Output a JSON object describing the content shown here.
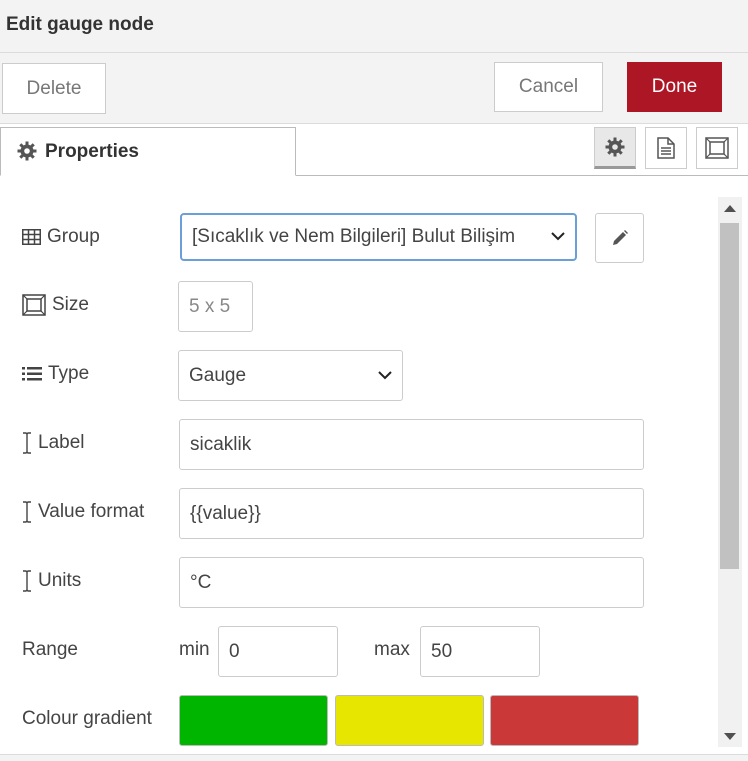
{
  "dialog": {
    "title": "Edit gauge node"
  },
  "toolbar": {
    "delete_label": "Delete",
    "cancel_label": "Cancel",
    "done_label": "Done"
  },
  "tabs": {
    "properties_label": "Properties",
    "active": "settings"
  },
  "form": {
    "group": {
      "label": "Group",
      "value": "[Sıcaklık ve Nem Bilgileri] Bulut Bilişim"
    },
    "size": {
      "label": "Size",
      "value": "5 x 5"
    },
    "type": {
      "label": "Type",
      "value": "Gauge"
    },
    "label_field": {
      "label": "Label",
      "value": "sicaklik"
    },
    "value_format": {
      "label": "Value format",
      "value": "{{value}}"
    },
    "units": {
      "label": "Units",
      "value": "°C"
    },
    "range": {
      "label": "Range",
      "min_label": "min",
      "min_value": "0",
      "max_label": "max",
      "max_value": "50"
    },
    "colour_gradient": {
      "label": "Colour gradient",
      "colors": [
        "#00b500",
        "#e6e600",
        "#ca3838"
      ]
    }
  },
  "colors": {
    "accent": "#ad1625",
    "focus": "#6a9fd8"
  }
}
